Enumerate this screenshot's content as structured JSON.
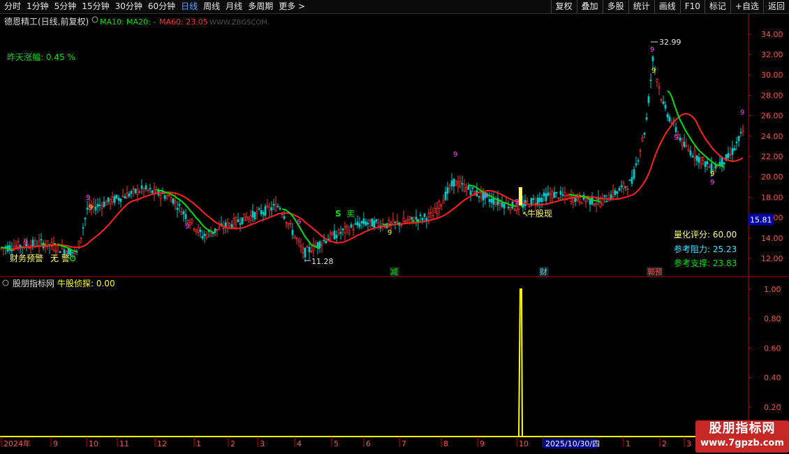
{
  "toolbar": {
    "periods": [
      "分时",
      "1分钟",
      "5分钟",
      "15分钟",
      "30分钟",
      "60分钟",
      "日线",
      "周线",
      "月线",
      "多周期",
      "更多 >"
    ],
    "active_index": 6,
    "buttons": [
      "复权",
      "叠加",
      "多股",
      "统计",
      "画线",
      "F10",
      "标记",
      "+自选",
      "返回"
    ]
  },
  "main_panel": {
    "title": "德恩精工(日线,前复权)",
    "ma10_label": "MA10:",
    "ma20_label": "MA20: -",
    "ma60_label": "MA60: 23.05",
    "watermark": "WWW.ZBGSCOM.",
    "left_note": "昨天涨幅: 0.45 %",
    "high_label": "32.99",
    "low_label": "11.28",
    "signal_label": "牛股现",
    "sell_label": "卖",
    "score_label": "量化评分: 60.00",
    "resistance_label": "参考阻力: 25.23",
    "support_label": "参考支撑: 23.83",
    "warning_label": "财务预警",
    "no_warning_label": "无 警",
    "event_labels": [
      "减",
      "财",
      "郭预"
    ],
    "price_tag": "15.81",
    "y_ticks": [
      "34.00",
      "32.00",
      "30.00",
      "28.00",
      "26.00",
      "24.00",
      "22.00",
      "20.00",
      "18.00",
      "16.00",
      "14.00",
      "12.00"
    ]
  },
  "sub_panel": {
    "title": "股朋指标网",
    "indicator_label": "牛股侦探: 0.00",
    "y_ticks": [
      "1.00",
      "0.80",
      "0.60",
      "0.40",
      "0.20"
    ]
  },
  "x_axis": {
    "labels": [
      "2024年",
      "9",
      "10",
      "11",
      "12",
      "1",
      "2",
      "3",
      "4",
      "5",
      "6",
      "7",
      "8",
      "9",
      "10",
      "2025/10/30/四",
      "1",
      "2",
      "3"
    ]
  },
  "logo": {
    "line1": "股朋指标网",
    "line2": "www.7gpzb.com"
  },
  "colors": {
    "up": "#ff3030",
    "down": "#00c8c8",
    "ma10": "#00e000",
    "ma60": "#ff2020",
    "yellow": "#ffff00",
    "axis": "#c00000"
  },
  "chart_data": {
    "type": "line",
    "title": "德恩精工(日线,前复权)",
    "y_range": [
      11,
      35
    ],
    "x": [
      "2024年",
      "9",
      "10",
      "11",
      "12",
      "1",
      "2",
      "3",
      "4",
      "5",
      "6",
      "7",
      "8",
      "9",
      "10",
      "2025/10/30/四",
      "1",
      "2",
      "3"
    ],
    "series": [
      {
        "name": "MA10",
        "values": [
          13.2,
          13.0,
          15.8,
          17.8,
          18.3,
          14.6,
          15.4,
          16.8,
          14.0,
          15.3,
          15.2,
          16.5,
          19.3,
          18.0,
          17.0,
          18.2,
          19.5,
          27.0,
          22.0
        ]
      },
      {
        "name": "MA60",
        "values": [
          12.8,
          12.6,
          14.6,
          16.8,
          18.0,
          15.0,
          15.1,
          16.2,
          14.3,
          15.0,
          15.5,
          16.0,
          18.2,
          18.5,
          17.5,
          17.8,
          19.0,
          25.5,
          22.6
        ]
      }
    ],
    "high": 32.99,
    "low": 11.28,
    "sub_indicator": {
      "name": "牛股侦探",
      "value": 0.0,
      "peak": 1.0,
      "y_range": [
        0,
        1.05
      ]
    }
  }
}
